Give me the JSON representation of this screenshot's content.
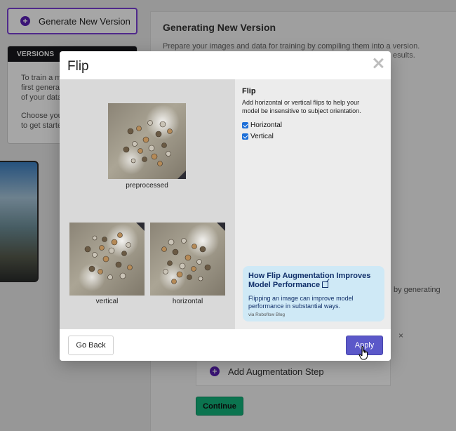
{
  "background": {
    "generate_button": {
      "label": "Generate New Version",
      "icon": "plus-circle-icon"
    },
    "versions": {
      "header": "VERSIONS",
      "line1": "To train a m",
      "line2": "first genera",
      "line3": "of your data",
      "line4": "Choose you",
      "line5": "to get starte"
    },
    "main": {
      "title": "Generating New Version",
      "desc_line1": "Prepare your images and data for training by compiling them into a version.",
      "desc_tail": "esults.",
      "side_text": "by generating",
      "remove_symbol": "×",
      "add_augmentation": "Add Augmentation Step",
      "continue_label": "Continue"
    }
  },
  "modal": {
    "title": "Flip",
    "close_icon": "close-icon",
    "preview": {
      "preprocessed_caption": "preprocessed",
      "vertical_caption": "vertical",
      "horizontal_caption": "horizontal"
    },
    "settings": {
      "heading": "Flip",
      "desc_line1": "Add horizontal or vertical flips to help your",
      "desc_line2": "model be insensitive to subject orientation.",
      "options": [
        {
          "label": "Horizontal",
          "checked": true
        },
        {
          "label": "Vertical",
          "checked": true
        }
      ]
    },
    "blog": {
      "title_line1": "How Flip Augmentation Improves",
      "title_line2": "Model Performance",
      "desc_line1": "Flipping an image can improve model",
      "desc_line2": "performance in substantial ways.",
      "source": "via Roboflow Blog",
      "link_icon": "external-link-icon"
    },
    "footer": {
      "back_label": "Go Back",
      "apply_label": "Apply"
    }
  },
  "colors": {
    "accent_purple": "#7b3fd6",
    "apply_button": "#5b58c9",
    "continue_button": "#12b27a",
    "blog_card": "#cfe9f6",
    "checkbox": "#1d6fd8"
  }
}
